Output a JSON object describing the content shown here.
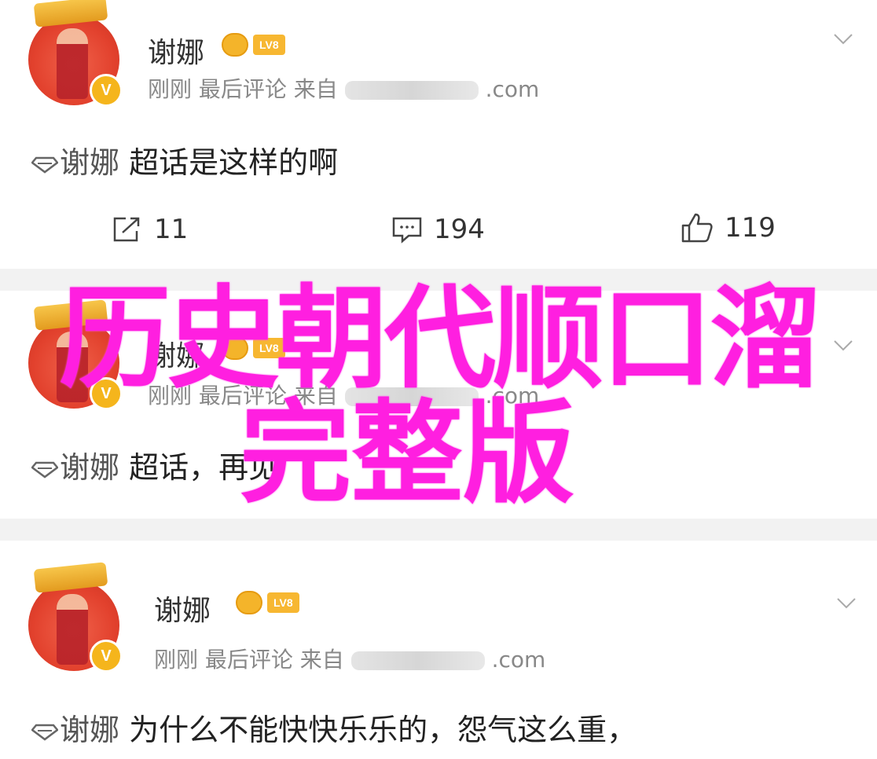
{
  "posts": [
    {
      "name": "谢娜",
      "level": "LV8",
      "meta_prefix": "刚刚 最后评论  来自",
      "meta_suffix": ".com",
      "tag": "谢娜",
      "text": "超话是这样的啊",
      "actions": {
        "share": "11",
        "comment": "194",
        "like": "119"
      }
    },
    {
      "name": "谢娜",
      "level": "LV8",
      "meta_prefix": "刚刚 最后评论  来自",
      "meta_suffix": ".com",
      "tag": "谢娜",
      "text": "超话，再见"
    },
    {
      "name": "谢娜",
      "level": "LV8",
      "meta_prefix": "刚刚 最后评论  来自",
      "meta_suffix": ".com",
      "tag": "谢娜",
      "text": "为什么不能快快乐乐的，怨气这么重，"
    }
  ],
  "overlay": {
    "line1": "历史朝代顺口溜",
    "line2": "完整版",
    "color": "#ff1fe0"
  },
  "icons": {
    "verified": "verified-v-icon",
    "share": "share-icon",
    "comment": "comment-icon",
    "like": "thumbs-up-icon"
  }
}
